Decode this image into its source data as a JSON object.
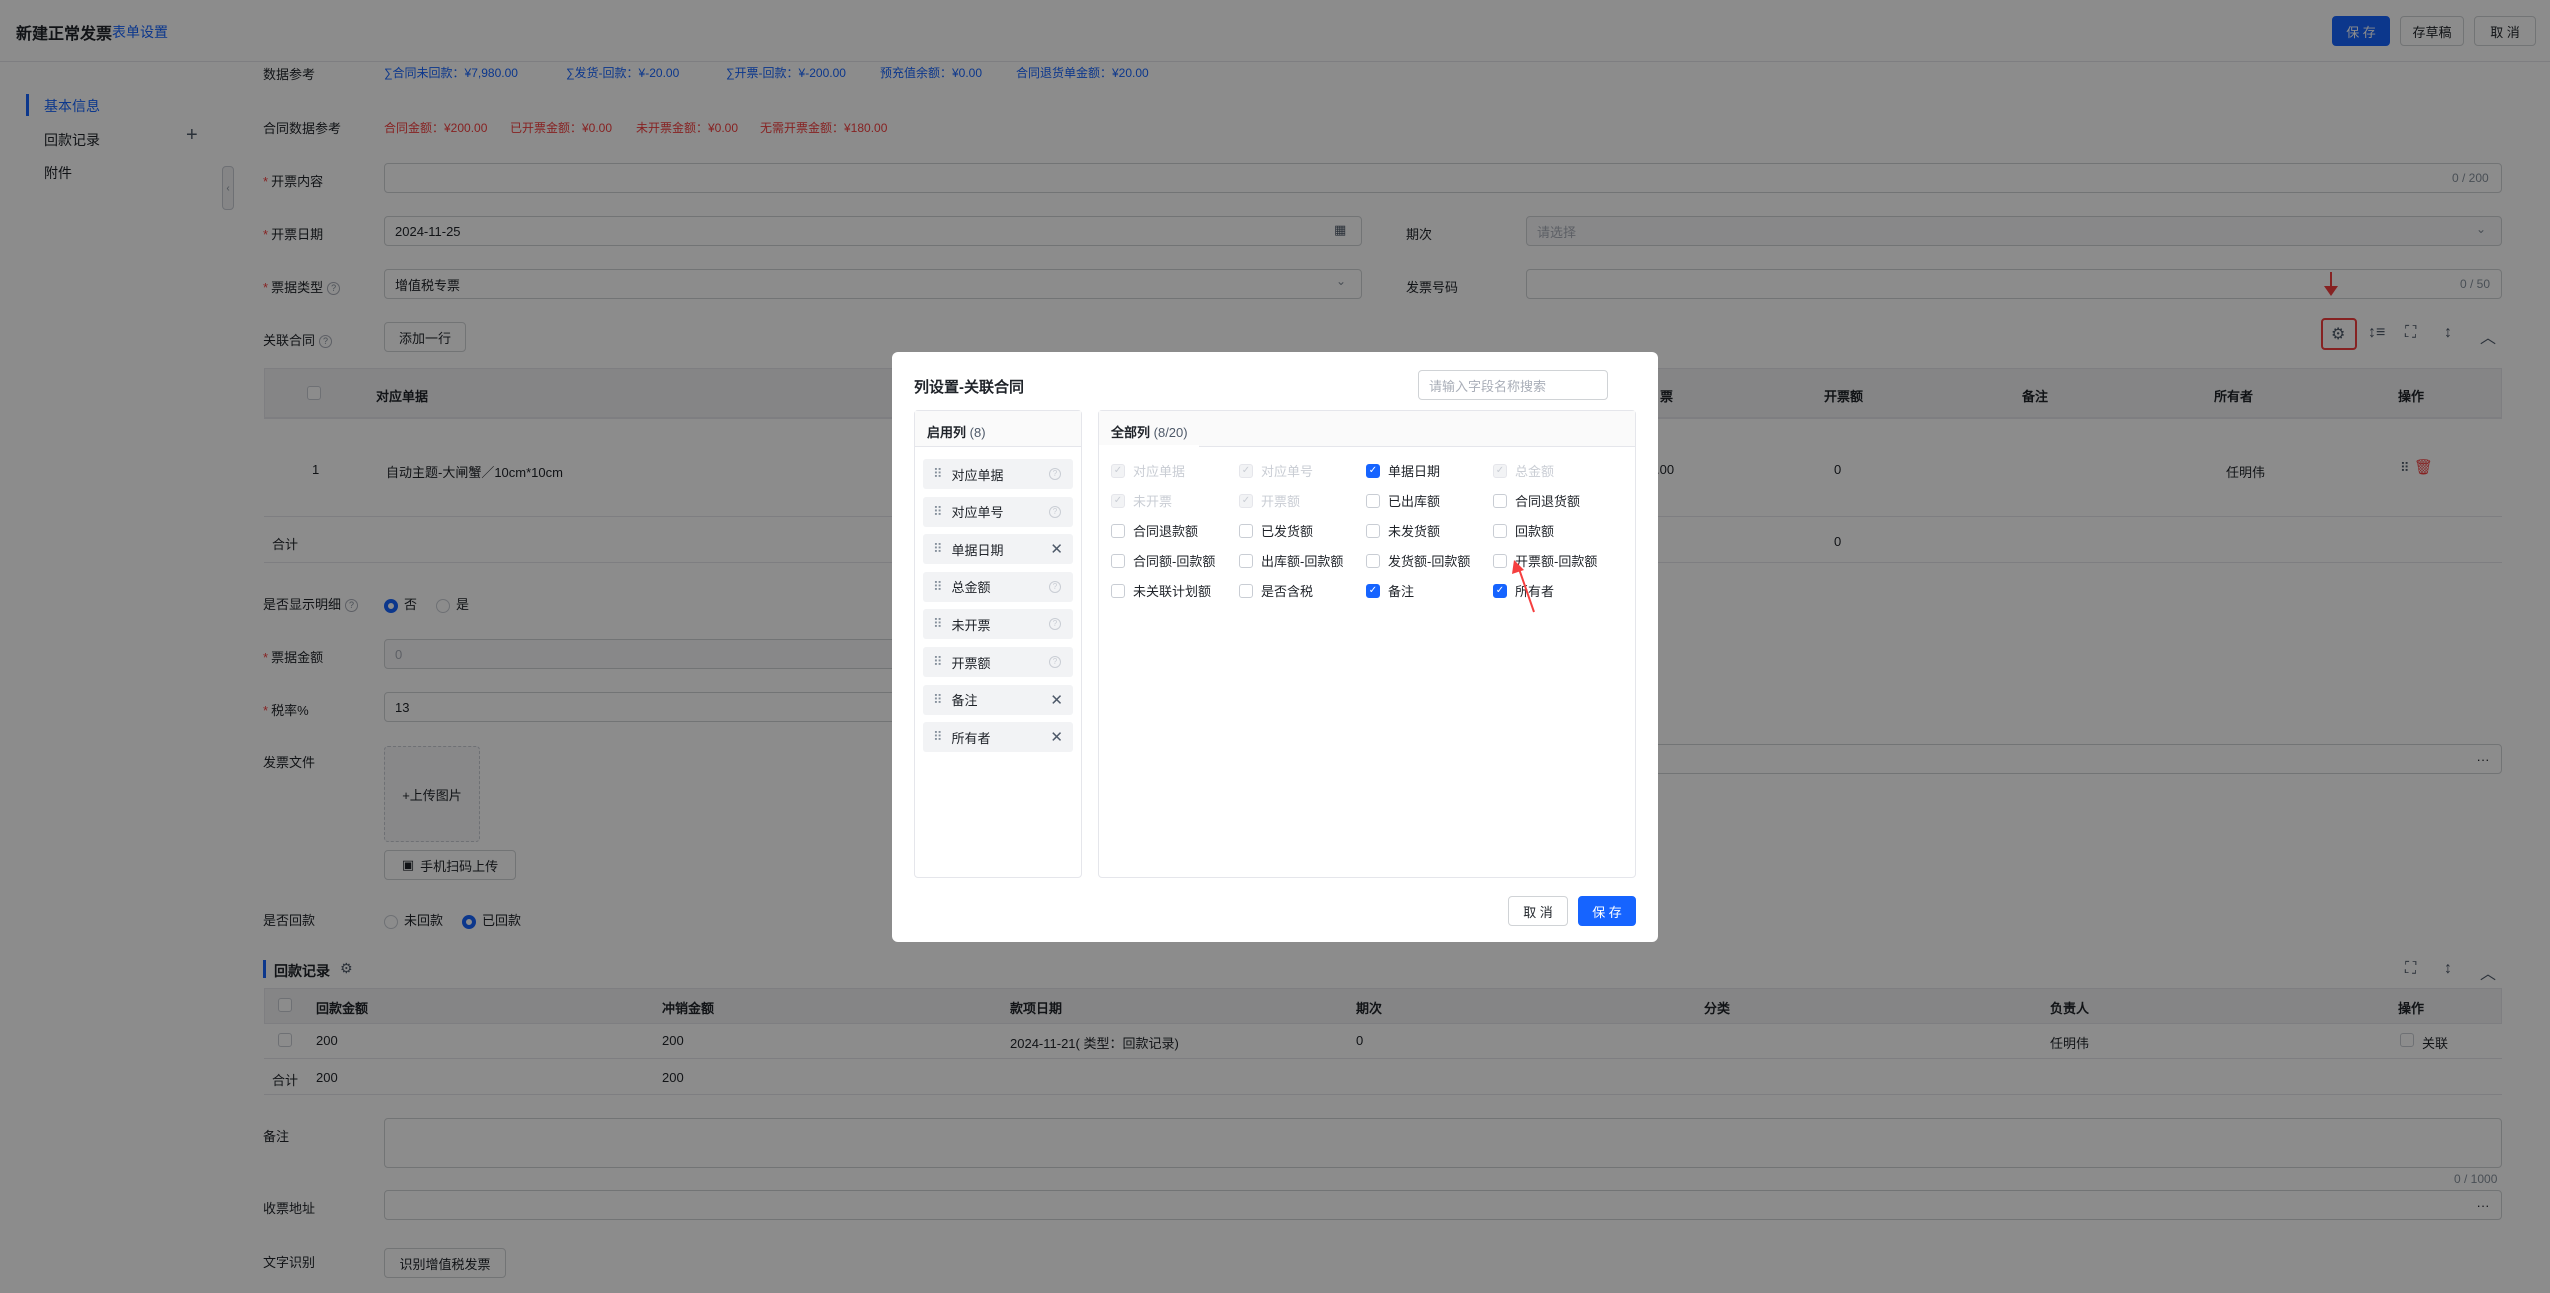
{
  "header": {
    "title": "新建正常发票",
    "form_settings": "表单设置",
    "save": "保 存",
    "draft": "存草稿",
    "cancel": "取 消"
  },
  "sidebar": {
    "items": [
      {
        "label": "基本信息"
      },
      {
        "label": "回款记录"
      },
      {
        "label": "附件"
      }
    ],
    "add_icon": "plus-icon"
  },
  "form": {
    "data_ref_label": "数据参考",
    "data_ref_items": [
      "∑合同未回款：¥7,980.00",
      "∑发货-回款：¥-20.00",
      "∑开票-回款：¥-200.00",
      "预充值余额：¥0.00",
      "合同退货单金额：¥20.00"
    ],
    "contract_ref_label": "合同数据参考",
    "contract_ref_items": [
      "合同金额：¥200.00",
      "已开票金额：¥0.00",
      "未开票金额：¥0.00",
      "无需开票金额：¥180.00"
    ],
    "invoice_content_label": "开票内容",
    "invoice_content_count": "0 / 200",
    "invoice_date_label": "开票日期",
    "invoice_date_value": "2024-11-25",
    "period_label": "期次",
    "period_placeholder": "请选择",
    "bill_type_label": "票据类型",
    "bill_type_value": "增值税专票",
    "invoice_no_label": "发票号码",
    "invoice_no_count": "0 / 50",
    "linked_contract_label": "关联合同",
    "add_row": "添加一行",
    "show_detail_label": "是否显示明细",
    "no": "否",
    "yes": "是",
    "bill_amount_label": "票据金额",
    "bill_amount_value": "0",
    "tax_rate_label": "税率%",
    "tax_rate_value": "13",
    "invoice_file_label": "发票文件",
    "upload_image": "+上传图片",
    "scan_upload": "手机扫码上传",
    "payment_label": "是否回款",
    "not_paid": "未回款",
    "paid": "已回款",
    "remark_label": "备注",
    "remark_count": "0 / 1000",
    "address_label": "收票地址",
    "ocr_label": "文字识别",
    "ocr_button": "识别增值税发票"
  },
  "contract_table": {
    "headers": [
      "对应单据",
      "票",
      "开票额",
      "备注",
      "所有者",
      "操作"
    ],
    "row": {
      "index": "1",
      "doc": "自动主题-大闸蟹／10cm*10cm",
      "amount_partial": ".00",
      "invoice_amount": "0",
      "owner": "任明伟"
    },
    "total_label": "合计",
    "total_invoice": "0"
  },
  "payment_section": {
    "title": "回款记录",
    "headers": [
      "回款金额",
      "冲销金额",
      "款项日期",
      "期次",
      "分类",
      "负责人",
      "操作"
    ],
    "row": {
      "amount": "200",
      "offset": "200",
      "date": "2024-11-21( 类型：回款记录)",
      "period": "0",
      "category": "",
      "owner": "任明伟",
      "action": "关联"
    },
    "total_label": "合计",
    "total_amount": "200",
    "total_offset": "200"
  },
  "modal": {
    "title": "列设置-关联合同",
    "search_placeholder": "请输入字段名称搜索",
    "enabled_tab": "启用列",
    "enabled_count": "(8)",
    "all_tab": "全部列",
    "all_count": "(8/20)",
    "enabled_items": [
      {
        "label": "对应单据",
        "removable": false
      },
      {
        "label": "对应单号",
        "removable": false
      },
      {
        "label": "单据日期",
        "removable": true
      },
      {
        "label": "总金额",
        "removable": false
      },
      {
        "label": "未开票",
        "removable": false
      },
      {
        "label": "开票额",
        "removable": false
      },
      {
        "label": "备注",
        "removable": true
      },
      {
        "label": "所有者",
        "removable": true
      }
    ],
    "all_items": [
      {
        "label": "对应单据",
        "state": "disabled"
      },
      {
        "label": "对应单号",
        "state": "disabled"
      },
      {
        "label": "单据日期",
        "state": "checked"
      },
      {
        "label": "总金额",
        "state": "disabled"
      },
      {
        "label": "未开票",
        "state": "disabled"
      },
      {
        "label": "开票额",
        "state": "disabled"
      },
      {
        "label": "已出库额",
        "state": "unchecked"
      },
      {
        "label": "合同退货额",
        "state": "unchecked"
      },
      {
        "label": "合同退款额",
        "state": "unchecked"
      },
      {
        "label": "已发货额",
        "state": "unchecked"
      },
      {
        "label": "未发货额",
        "state": "unchecked"
      },
      {
        "label": "回款额",
        "state": "unchecked"
      },
      {
        "label": "合同额-回款额",
        "state": "unchecked"
      },
      {
        "label": "出库额-回款额",
        "state": "unchecked"
      },
      {
        "label": "发货额-回款额",
        "state": "unchecked"
      },
      {
        "label": "开票额-回款额",
        "state": "unchecked"
      },
      {
        "label": "未关联计划额",
        "state": "unchecked"
      },
      {
        "label": "是否含税",
        "state": "unchecked"
      },
      {
        "label": "备注",
        "state": "checked"
      },
      {
        "label": "所有者",
        "state": "checked"
      }
    ],
    "cancel": "取 消",
    "save": "保 存"
  },
  "colors": {
    "primary": "#1664ff",
    "danger": "#f53f3f",
    "amount_orange": "#f53f3f"
  }
}
